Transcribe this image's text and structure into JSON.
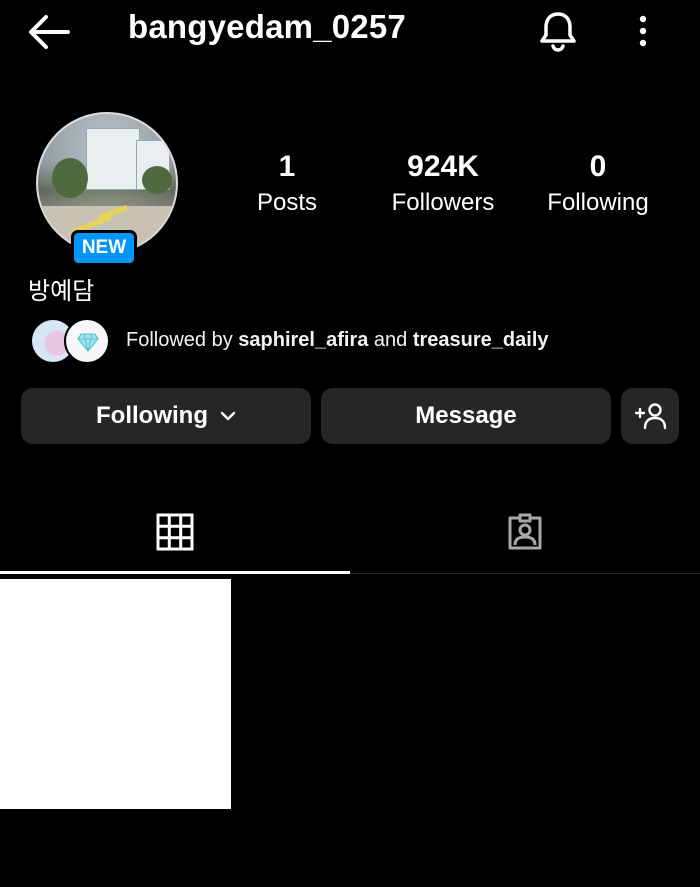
{
  "header": {
    "username": "bangyedam_0257",
    "icons": {
      "back": "arrow-left-icon",
      "notifications": "bell-icon",
      "more": "more-vertical-icon"
    }
  },
  "profile": {
    "badge": "NEW",
    "display_name": "방예담",
    "stats": [
      {
        "value": "1",
        "label": "Posts"
      },
      {
        "value": "924K",
        "label": "Followers"
      },
      {
        "value": "0",
        "label": "Following"
      }
    ],
    "followed_by": {
      "prefix": "Followed by",
      "user1": "saphirel_afira",
      "conjunction": "and",
      "user2": "treasure_daily"
    }
  },
  "actions": {
    "following_label": "Following",
    "message_label": "Message",
    "add_user_icon": "add-person-icon"
  },
  "tabs": [
    {
      "icon": "grid-icon",
      "active": true
    },
    {
      "icon": "tagged-person-icon",
      "active": false
    }
  ],
  "colors": {
    "background": "#000000",
    "button": "#262626",
    "badge": "#0095f6",
    "text": "#ffffff"
  }
}
